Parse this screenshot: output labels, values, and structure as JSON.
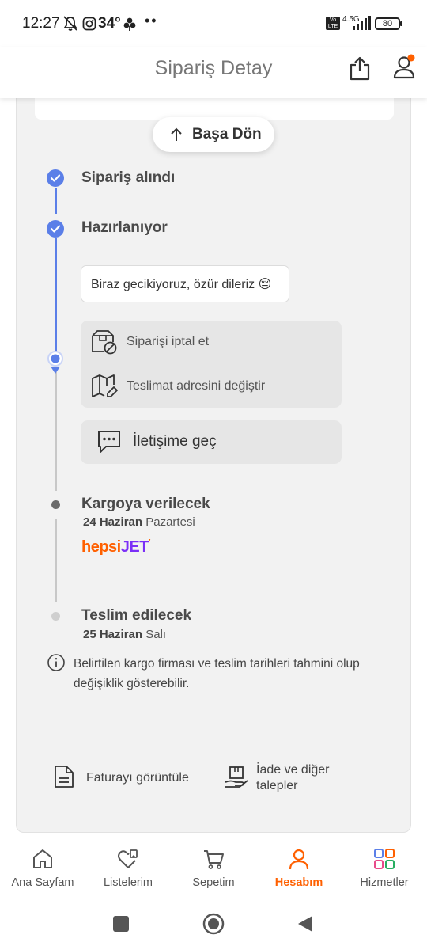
{
  "status_bar": {
    "time": "12:27",
    "temperature": "34°",
    "dots": "••",
    "network": "4.5G",
    "battery": "80"
  },
  "header": {
    "title": "Sipariş Detay",
    "icons": [
      "share-icon",
      "account-icon"
    ]
  },
  "back_to_top": {
    "label": "Başa Dön",
    "icon": "arrow-up-icon"
  },
  "timeline": {
    "steps": [
      {
        "title": "Sipariş alındı",
        "state": "done"
      },
      {
        "title": "Hazırlanıyor",
        "state": "done"
      },
      {
        "title": "Kargoya verilecek",
        "date_bold": "24 Haziran",
        "date_rest": "Pazartesi",
        "state": "pending"
      },
      {
        "title": "Teslim edilecek",
        "date_bold": "25 Haziran",
        "date_rest": "Salı",
        "state": "pending"
      }
    ],
    "delay_message": "Biraz gecikiyoruz, özür dileriz 😔",
    "actions": [
      {
        "label": "Siparişi iptal et",
        "icon": "box-cancel-icon"
      },
      {
        "label": "Teslimat adresini değiştir",
        "icon": "map-edit-icon"
      }
    ],
    "contact": {
      "label": "İletişime geç",
      "icon": "chat-dots-icon"
    },
    "carrier": {
      "part1": "hepsi",
      "part2": "JET",
      "color1": "#ff6000",
      "color2": "#7b2ff7"
    }
  },
  "info_note": {
    "icon": "info-icon",
    "text": "Belirtilen kargo firması ve teslim tarihleri tahmini olup değişiklik gösterebilir."
  },
  "bottom_actions": [
    {
      "label": "Faturayı görüntüle",
      "icon": "invoice-icon"
    },
    {
      "label_line1": "İade ve diğer",
      "label_line2": "talepler",
      "icon": "return-box-icon"
    }
  ],
  "bottom_nav": {
    "items": [
      {
        "label": "Ana Sayfam",
        "icon": "home-icon",
        "active": false
      },
      {
        "label": "Listelerim",
        "icon": "heart-list-icon",
        "active": false
      },
      {
        "label": "Sepetim",
        "icon": "cart-icon",
        "active": false
      },
      {
        "label": "Hesabım",
        "icon": "user-icon",
        "active": true
      },
      {
        "label": "Hizmetler",
        "icon": "services-grid-icon",
        "active": false
      }
    ]
  },
  "colors": {
    "accent": "#ff6000",
    "timeline_blue": "#5b7fe8",
    "inactive_gray": "#c8c8c8"
  }
}
